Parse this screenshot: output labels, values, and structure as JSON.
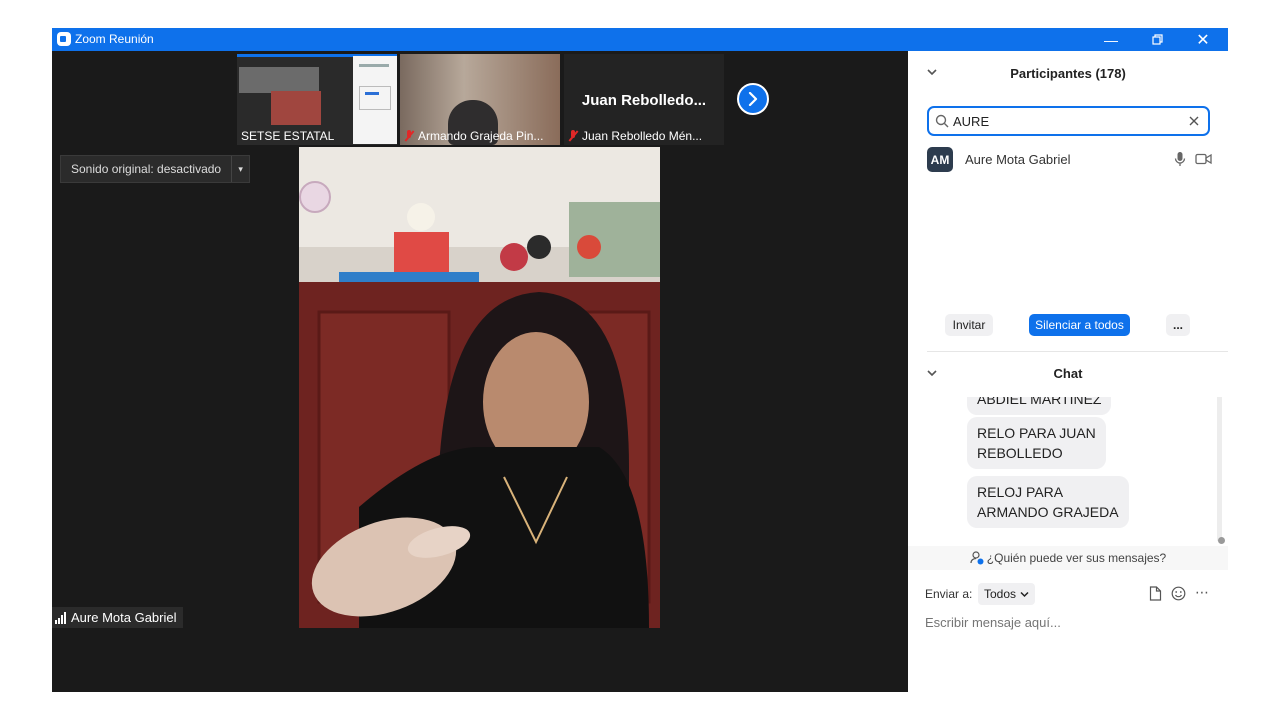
{
  "window": {
    "title": "Zoom Reunión",
    "controls": [
      "minimize",
      "restore",
      "close"
    ]
  },
  "thumbnails": [
    {
      "name": "SETSE ESTATAL",
      "muted": false
    },
    {
      "name": "Armando Grajeda Pin...",
      "muted": true
    },
    {
      "name": "Juan Rebolledo Mén...",
      "big_name": "Juan  Rebolledo...",
      "muted": true
    }
  ],
  "next_icon": "chevron-right-icon",
  "sound": {
    "label": "Sonido original: desactivado",
    "caret": "▾"
  },
  "speaker": {
    "name": "Aure Mota Gabriel"
  },
  "participants": {
    "title": "Participantes (178)",
    "search_value": "AURE",
    "list": [
      {
        "initials": "AM",
        "name": "Aure Mota Gabriel"
      }
    ],
    "buttons": {
      "invite": "Invitar",
      "mute_all": "Silenciar a todos",
      "more": "..."
    }
  },
  "chat": {
    "title": "Chat",
    "messages": [
      "ABDIEL MARTINEZ",
      "RELO PARA JUAN\nREBOLLEDO",
      "RELOJ PARA\nARMANDO GRAJEDA"
    ],
    "who_can_see": "¿Quién puede ver sus mensajes?",
    "send_to_label": "Enviar a:",
    "send_to_value": "Todos",
    "input_placeholder": "Escribir mensaje aquí..."
  },
  "colors": {
    "accent": "#0e71eb",
    "video_bg": "#1a1a1a",
    "muted": "#e02828",
    "avatar": "#2d3c4e"
  }
}
